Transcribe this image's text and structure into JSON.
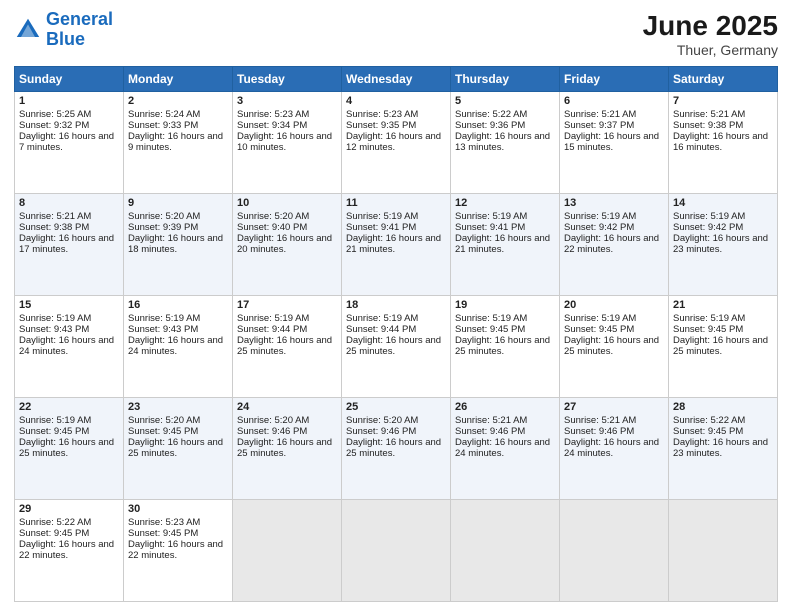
{
  "header": {
    "logo_general": "General",
    "logo_blue": "Blue",
    "month_title": "June 2025",
    "location": "Thuer, Germany"
  },
  "days_of_week": [
    "Sunday",
    "Monday",
    "Tuesday",
    "Wednesday",
    "Thursday",
    "Friday",
    "Saturday"
  ],
  "weeks": [
    [
      {
        "day": "1",
        "sunrise": "Sunrise: 5:25 AM",
        "sunset": "Sunset: 9:32 PM",
        "daylight": "Daylight: 16 hours and 7 minutes."
      },
      {
        "day": "2",
        "sunrise": "Sunrise: 5:24 AM",
        "sunset": "Sunset: 9:33 PM",
        "daylight": "Daylight: 16 hours and 9 minutes."
      },
      {
        "day": "3",
        "sunrise": "Sunrise: 5:23 AM",
        "sunset": "Sunset: 9:34 PM",
        "daylight": "Daylight: 16 hours and 10 minutes."
      },
      {
        "day": "4",
        "sunrise": "Sunrise: 5:23 AM",
        "sunset": "Sunset: 9:35 PM",
        "daylight": "Daylight: 16 hours and 12 minutes."
      },
      {
        "day": "5",
        "sunrise": "Sunrise: 5:22 AM",
        "sunset": "Sunset: 9:36 PM",
        "daylight": "Daylight: 16 hours and 13 minutes."
      },
      {
        "day": "6",
        "sunrise": "Sunrise: 5:21 AM",
        "sunset": "Sunset: 9:37 PM",
        "daylight": "Daylight: 16 hours and 15 minutes."
      },
      {
        "day": "7",
        "sunrise": "Sunrise: 5:21 AM",
        "sunset": "Sunset: 9:38 PM",
        "daylight": "Daylight: 16 hours and 16 minutes."
      }
    ],
    [
      {
        "day": "8",
        "sunrise": "Sunrise: 5:21 AM",
        "sunset": "Sunset: 9:38 PM",
        "daylight": "Daylight: 16 hours and 17 minutes."
      },
      {
        "day": "9",
        "sunrise": "Sunrise: 5:20 AM",
        "sunset": "Sunset: 9:39 PM",
        "daylight": "Daylight: 16 hours and 18 minutes."
      },
      {
        "day": "10",
        "sunrise": "Sunrise: 5:20 AM",
        "sunset": "Sunset: 9:40 PM",
        "daylight": "Daylight: 16 hours and 20 minutes."
      },
      {
        "day": "11",
        "sunrise": "Sunrise: 5:19 AM",
        "sunset": "Sunset: 9:41 PM",
        "daylight": "Daylight: 16 hours and 21 minutes."
      },
      {
        "day": "12",
        "sunrise": "Sunrise: 5:19 AM",
        "sunset": "Sunset: 9:41 PM",
        "daylight": "Daylight: 16 hours and 21 minutes."
      },
      {
        "day": "13",
        "sunrise": "Sunrise: 5:19 AM",
        "sunset": "Sunset: 9:42 PM",
        "daylight": "Daylight: 16 hours and 22 minutes."
      },
      {
        "day": "14",
        "sunrise": "Sunrise: 5:19 AM",
        "sunset": "Sunset: 9:42 PM",
        "daylight": "Daylight: 16 hours and 23 minutes."
      }
    ],
    [
      {
        "day": "15",
        "sunrise": "Sunrise: 5:19 AM",
        "sunset": "Sunset: 9:43 PM",
        "daylight": "Daylight: 16 hours and 24 minutes."
      },
      {
        "day": "16",
        "sunrise": "Sunrise: 5:19 AM",
        "sunset": "Sunset: 9:43 PM",
        "daylight": "Daylight: 16 hours and 24 minutes."
      },
      {
        "day": "17",
        "sunrise": "Sunrise: 5:19 AM",
        "sunset": "Sunset: 9:44 PM",
        "daylight": "Daylight: 16 hours and 25 minutes."
      },
      {
        "day": "18",
        "sunrise": "Sunrise: 5:19 AM",
        "sunset": "Sunset: 9:44 PM",
        "daylight": "Daylight: 16 hours and 25 minutes."
      },
      {
        "day": "19",
        "sunrise": "Sunrise: 5:19 AM",
        "sunset": "Sunset: 9:45 PM",
        "daylight": "Daylight: 16 hours and 25 minutes."
      },
      {
        "day": "20",
        "sunrise": "Sunrise: 5:19 AM",
        "sunset": "Sunset: 9:45 PM",
        "daylight": "Daylight: 16 hours and 25 minutes."
      },
      {
        "day": "21",
        "sunrise": "Sunrise: 5:19 AM",
        "sunset": "Sunset: 9:45 PM",
        "daylight": "Daylight: 16 hours and 25 minutes."
      }
    ],
    [
      {
        "day": "22",
        "sunrise": "Sunrise: 5:19 AM",
        "sunset": "Sunset: 9:45 PM",
        "daylight": "Daylight: 16 hours and 25 minutes."
      },
      {
        "day": "23",
        "sunrise": "Sunrise: 5:20 AM",
        "sunset": "Sunset: 9:45 PM",
        "daylight": "Daylight: 16 hours and 25 minutes."
      },
      {
        "day": "24",
        "sunrise": "Sunrise: 5:20 AM",
        "sunset": "Sunset: 9:46 PM",
        "daylight": "Daylight: 16 hours and 25 minutes."
      },
      {
        "day": "25",
        "sunrise": "Sunrise: 5:20 AM",
        "sunset": "Sunset: 9:46 PM",
        "daylight": "Daylight: 16 hours and 25 minutes."
      },
      {
        "day": "26",
        "sunrise": "Sunrise: 5:21 AM",
        "sunset": "Sunset: 9:46 PM",
        "daylight": "Daylight: 16 hours and 24 minutes."
      },
      {
        "day": "27",
        "sunrise": "Sunrise: 5:21 AM",
        "sunset": "Sunset: 9:46 PM",
        "daylight": "Daylight: 16 hours and 24 minutes."
      },
      {
        "day": "28",
        "sunrise": "Sunrise: 5:22 AM",
        "sunset": "Sunset: 9:45 PM",
        "daylight": "Daylight: 16 hours and 23 minutes."
      }
    ],
    [
      {
        "day": "29",
        "sunrise": "Sunrise: 5:22 AM",
        "sunset": "Sunset: 9:45 PM",
        "daylight": "Daylight: 16 hours and 22 minutes."
      },
      {
        "day": "30",
        "sunrise": "Sunrise: 5:23 AM",
        "sunset": "Sunset: 9:45 PM",
        "daylight": "Daylight: 16 hours and 22 minutes."
      },
      {
        "day": "",
        "sunrise": "",
        "sunset": "",
        "daylight": ""
      },
      {
        "day": "",
        "sunrise": "",
        "sunset": "",
        "daylight": ""
      },
      {
        "day": "",
        "sunrise": "",
        "sunset": "",
        "daylight": ""
      },
      {
        "day": "",
        "sunrise": "",
        "sunset": "",
        "daylight": ""
      },
      {
        "day": "",
        "sunrise": "",
        "sunset": "",
        "daylight": ""
      }
    ]
  ]
}
